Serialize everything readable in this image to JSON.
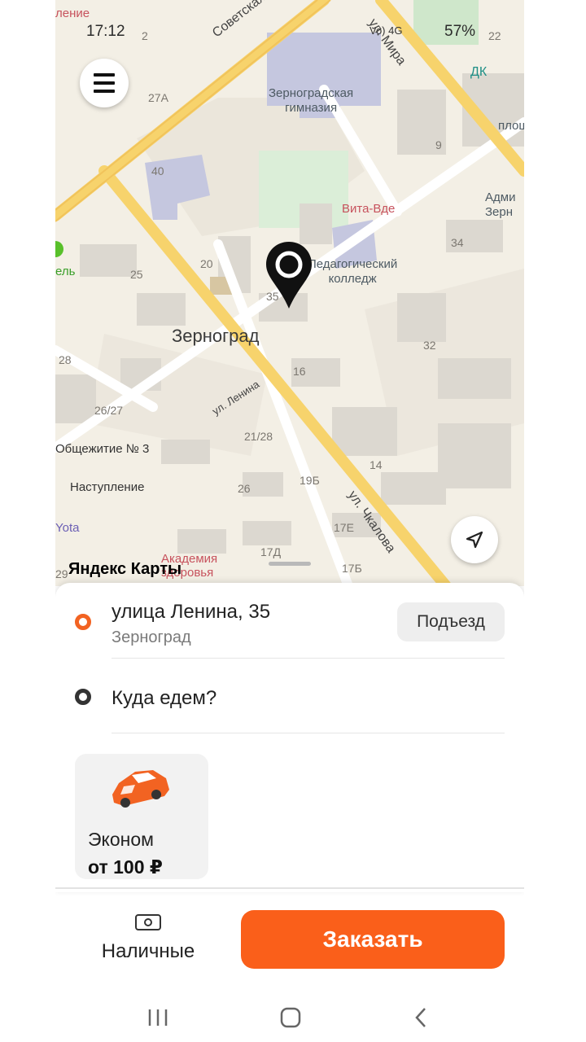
{
  "status_bar": {
    "time": "17:12",
    "battery": "57%",
    "signal": "Vo) 4G"
  },
  "map": {
    "city": "Зерноград",
    "streets": {
      "sovetskaya": "Советская ул.",
      "mira": "ул. Мира",
      "lenina": "ул. Ленина",
      "chkalova": "ул. Чкалова"
    },
    "pois": {
      "gymnasium": "Зерноградская\nгимназия",
      "college": "Педагогический\nколледж",
      "vita": "Вита-Вде",
      "dk": "ДК",
      "admin": "Адми\nЗерн",
      "ploshch": "плош",
      "obshch": "Общежитие № 3",
      "nastuplenie": "Наступление",
      "yota": "Yota",
      "academy": "Академия\nздоровья",
      "partial_top": "ление",
      "partial_left": "ель"
    },
    "numbers": [
      "27А",
      "2",
      "22",
      "9",
      "40",
      "34",
      "25",
      "20",
      "35",
      "32",
      "16",
      "28",
      "26/27",
      "21/28",
      "14",
      "19Б",
      "26",
      "17Е",
      "17Д",
      "17Б",
      "29"
    ],
    "logo_text": "Яндекс Карты"
  },
  "ride": {
    "pickup_address": "улица Ленина, 35",
    "pickup_city": "Зерноград",
    "entrance_button": "Подъезд",
    "destination_placeholder": "Куда едем?",
    "tariff": {
      "name": "Эконом",
      "price": "от 100 ₽"
    }
  },
  "footer": {
    "payment_label": "Наличные",
    "order_button": "Заказать"
  },
  "colors": {
    "accent": "#fa5f1a",
    "pin": "#111111",
    "road": "#f6d36b"
  }
}
